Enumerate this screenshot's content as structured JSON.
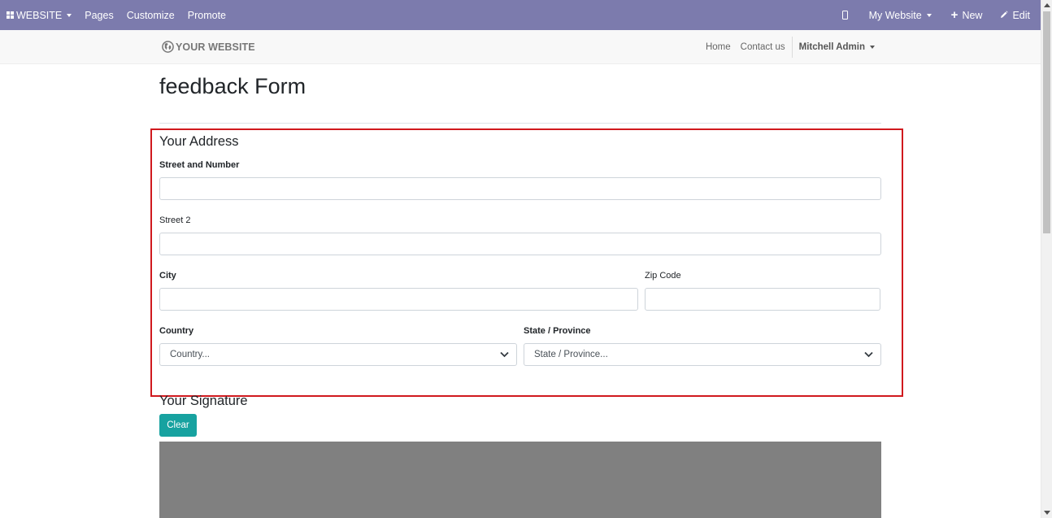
{
  "admin_bar": {
    "app_label": "WEBSITE",
    "menu": [
      "Pages",
      "Customize",
      "Promote"
    ],
    "website_selector": "My Website",
    "new_label": "New",
    "edit_label": "Edit"
  },
  "site_header": {
    "logo_text": "YOUR WEBSITE",
    "nav": [
      "Home",
      "Contact us"
    ],
    "user": "Mitchell Admin"
  },
  "page": {
    "title": "feedback Form"
  },
  "address_section": {
    "heading": "Your Address",
    "street_label": "Street and Number",
    "street2_label": "Street 2",
    "city_label": "City",
    "zip_label": "Zip Code",
    "country_label": "Country",
    "country_placeholder": "Country...",
    "state_label": "State / Province",
    "state_placeholder": "State / Province..."
  },
  "signature_section": {
    "heading": "Your Signature",
    "clear_label": "Clear"
  },
  "colors": {
    "admin_bar": "#7c7bad",
    "highlight": "#d0191e",
    "clear_button": "#17a2a0",
    "signature_pad": "#808080"
  }
}
